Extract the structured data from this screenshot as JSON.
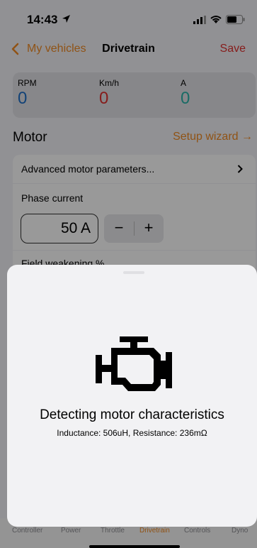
{
  "status": {
    "time": "14:43"
  },
  "nav": {
    "back_label": "My vehicles",
    "title": "Drivetrain",
    "save_label": "Save"
  },
  "telemetry": [
    {
      "label": "RPM",
      "value": "0",
      "color": "#1f6fc7"
    },
    {
      "label": "Km/h",
      "value": "0",
      "color": "#e0312f"
    },
    {
      "label": "A",
      "value": "0",
      "color": "#2bb3a8"
    }
  ],
  "motor": {
    "section_title": "Motor",
    "setup_wizard_label": "Setup wizard →",
    "advanced_label": "Advanced motor parameters...",
    "phase_current_label": "Phase current",
    "phase_current_value": "50 A",
    "decrement_label": "−",
    "increment_label": "+",
    "field_weakening_label": "Field weakening %"
  },
  "tabs": [
    {
      "label": "Controller",
      "active": false
    },
    {
      "label": "Power",
      "active": false
    },
    {
      "label": "Throttle",
      "active": false
    },
    {
      "label": "Drivetrain",
      "active": true
    },
    {
      "label": "Controls",
      "active": false
    },
    {
      "label": "Dyno",
      "active": false
    }
  ],
  "modal": {
    "icon": "engine-icon",
    "title": "Detecting motor characteristics",
    "subtitle": "Inductance: 506uH, Resistance: 236mΩ"
  },
  "colors": {
    "accent": "#f08a24",
    "save": "#e0312f"
  }
}
